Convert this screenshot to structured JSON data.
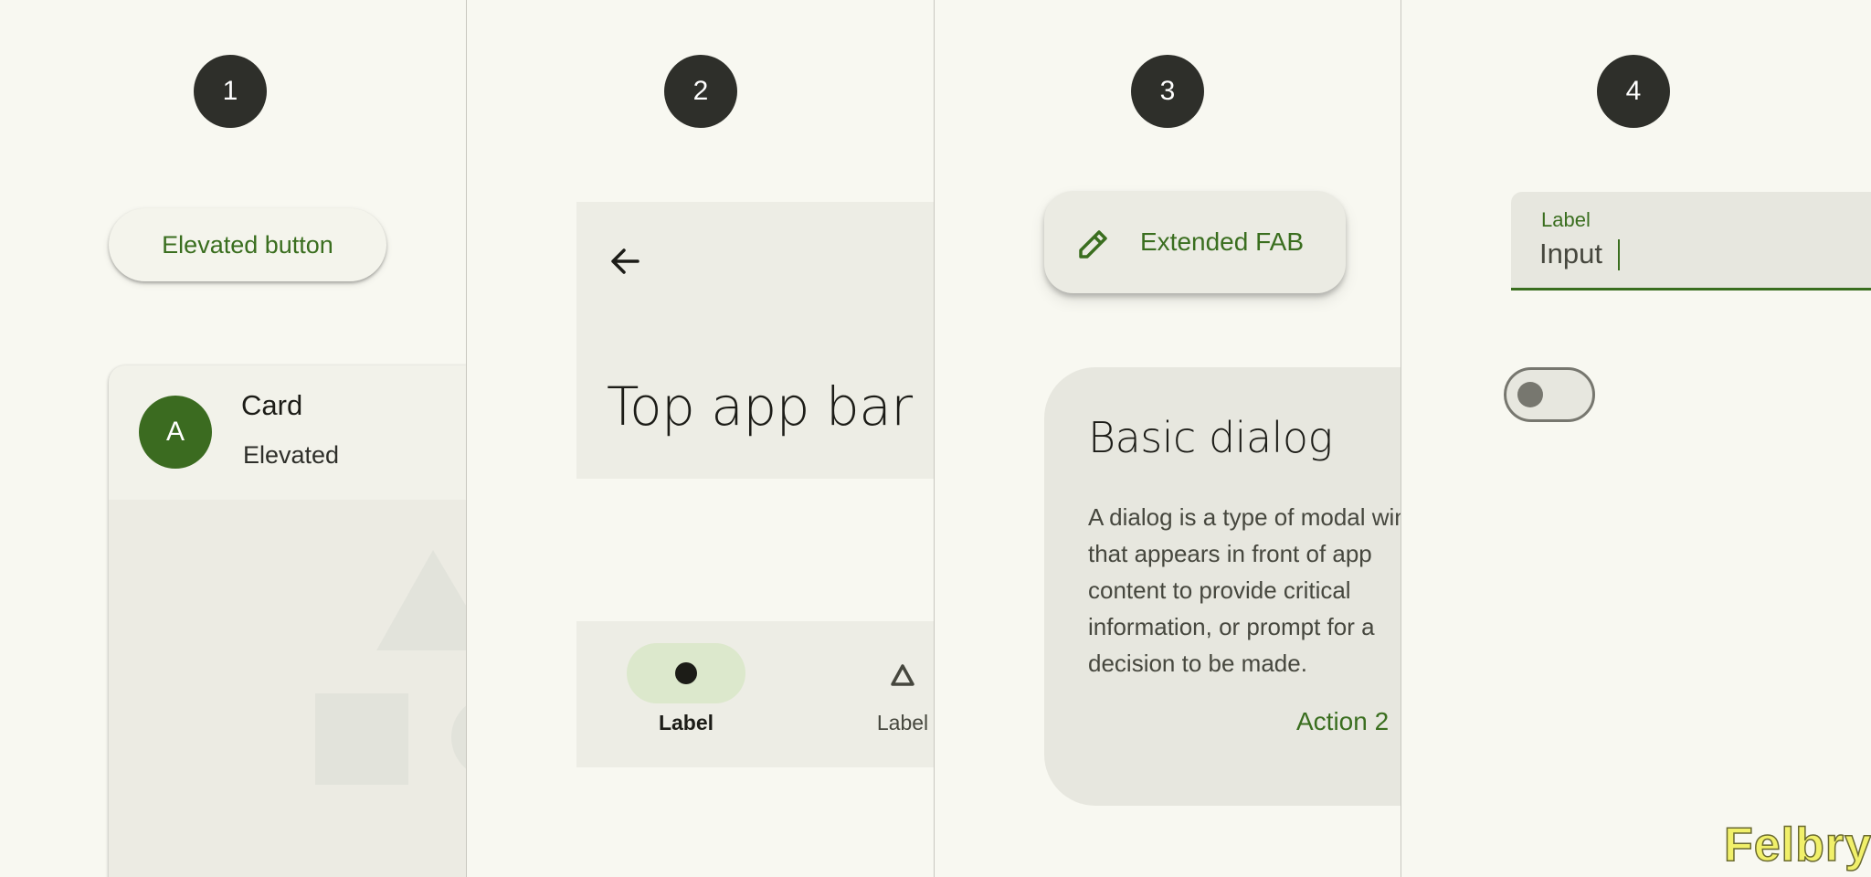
{
  "panels": [
    {
      "number": "1",
      "elevated_button": {
        "label": "Elevated button"
      },
      "card": {
        "avatar_initial": "A",
        "title": "Card",
        "subtitle": "Elevated"
      }
    },
    {
      "number": "2",
      "top_app_bar": {
        "title": "Top app bar",
        "nav_icon": "arrow-back-icon"
      },
      "navigation_bar": {
        "items": [
          {
            "label": "Label",
            "icon": "circle-icon",
            "selected": true
          },
          {
            "label": "Label",
            "icon": "triangle-icon",
            "selected": false
          }
        ]
      }
    },
    {
      "number": "3",
      "extended_fab": {
        "label": "Extended FAB",
        "icon": "pencil-icon"
      },
      "dialog": {
        "title": "Basic dialog",
        "body": "A dialog is a type of modal window that appears in front of app content to provide critical information, or prompt for a decision to be made.",
        "action": "Action 2"
      }
    },
    {
      "number": "4",
      "text_field": {
        "label": "Label",
        "value": "Input"
      },
      "switch": {
        "checked": false
      }
    }
  ],
  "watermark": "Felbry",
  "colors": {
    "background": "#f8f8f1",
    "primary": "#3a6e1f",
    "avatar": "#3b6b20",
    "badge": "#2e2f2a",
    "nav_indicator": "#dce8cc"
  }
}
